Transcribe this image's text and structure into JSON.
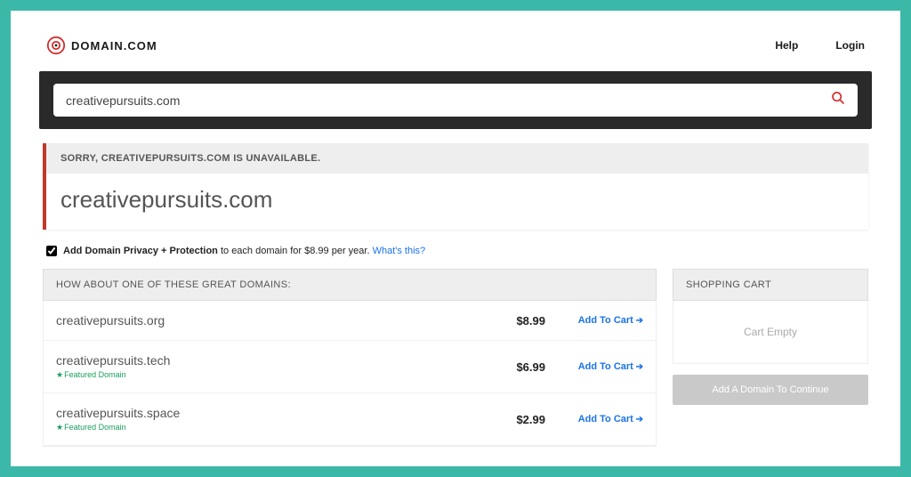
{
  "header": {
    "brand": "DOMAIN.COM",
    "nav": {
      "help": "Help",
      "login": "Login"
    }
  },
  "search": {
    "value": "creativepursuits.com"
  },
  "status": {
    "message": "SORRY, CREATIVEPURSUITS.COM IS UNAVAILABLE.",
    "domain": "creativepursuits.com"
  },
  "privacy": {
    "checked": true,
    "bold": "Add Domain Privacy + Protection",
    "rest": " to each domain for $8.99 per year. ",
    "link": "What's this?"
  },
  "suggestions": {
    "title": "HOW ABOUT ONE OF THESE GREAT DOMAINS:",
    "items": [
      {
        "name": "creativepursuits.org",
        "price": "$8.99",
        "featured": false,
        "cta": "Add To Cart"
      },
      {
        "name": "creativepursuits.tech",
        "price": "$6.99",
        "featured": true,
        "featured_label": "Featured Domain",
        "cta": "Add To Cart"
      },
      {
        "name": "creativepursuits.space",
        "price": "$2.99",
        "featured": true,
        "featured_label": "Featured Domain",
        "cta": "Add To Cart"
      }
    ]
  },
  "cart": {
    "title": "SHOPPING CART",
    "empty": "Cart Empty",
    "button": "Add A Domain To Continue"
  }
}
